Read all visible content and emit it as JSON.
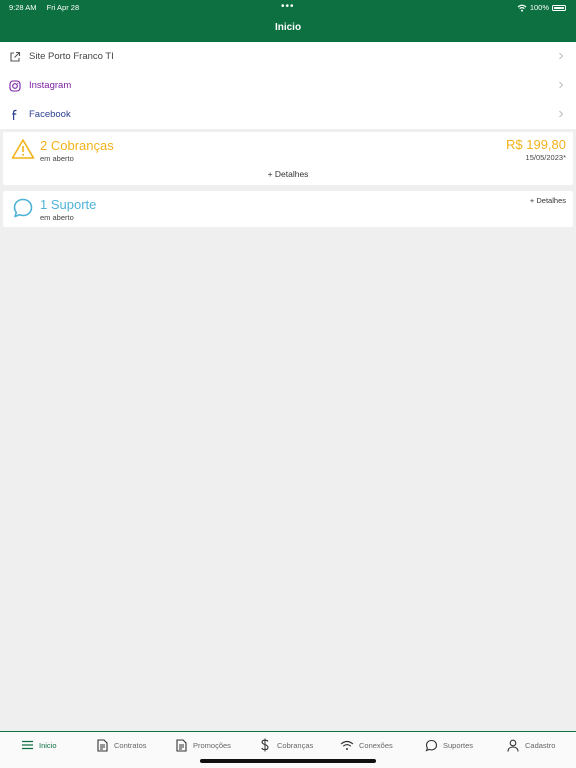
{
  "status": {
    "time": "9:28 AM",
    "date": "Fri Apr 28",
    "dots": "•••",
    "battery": "100%"
  },
  "header": {
    "title": "Inicio"
  },
  "links": [
    {
      "label": "Site Porto Franco TI",
      "icon": "external-link-icon",
      "color": "#444444"
    },
    {
      "label": "Instagram",
      "icon": "instagram-icon",
      "color": "#7b1fa2"
    },
    {
      "label": "Facebook",
      "icon": "facebook-icon",
      "color": "#2c3e91"
    }
  ],
  "cobrancas_card": {
    "title": "2 Cobranças",
    "subtitle": "em aberto",
    "amount": "R$ 199,80",
    "due": "15/05/2023*",
    "details": "+ Detalhes",
    "color": "#f2b21a"
  },
  "suporte_card": {
    "title": "1 Suporte",
    "subtitle": "em aberto",
    "details": "+ Detalhes",
    "color": "#4eb2d8"
  },
  "tabs": [
    {
      "label": "Inicio",
      "icon": "menu-icon",
      "active": true
    },
    {
      "label": "Contratos",
      "icon": "document-icon",
      "active": false
    },
    {
      "label": "Promoções",
      "icon": "document-icon",
      "active": false
    },
    {
      "label": "Cobranças",
      "icon": "dollar-icon",
      "active": false
    },
    {
      "label": "Conexões",
      "icon": "wifi-icon",
      "active": false
    },
    {
      "label": "Suportes",
      "icon": "chat-icon",
      "active": false
    },
    {
      "label": "Cadastro",
      "icon": "user-icon",
      "active": false
    }
  ],
  "colors": {
    "brand": "#0c7040",
    "background": "#efefef"
  }
}
